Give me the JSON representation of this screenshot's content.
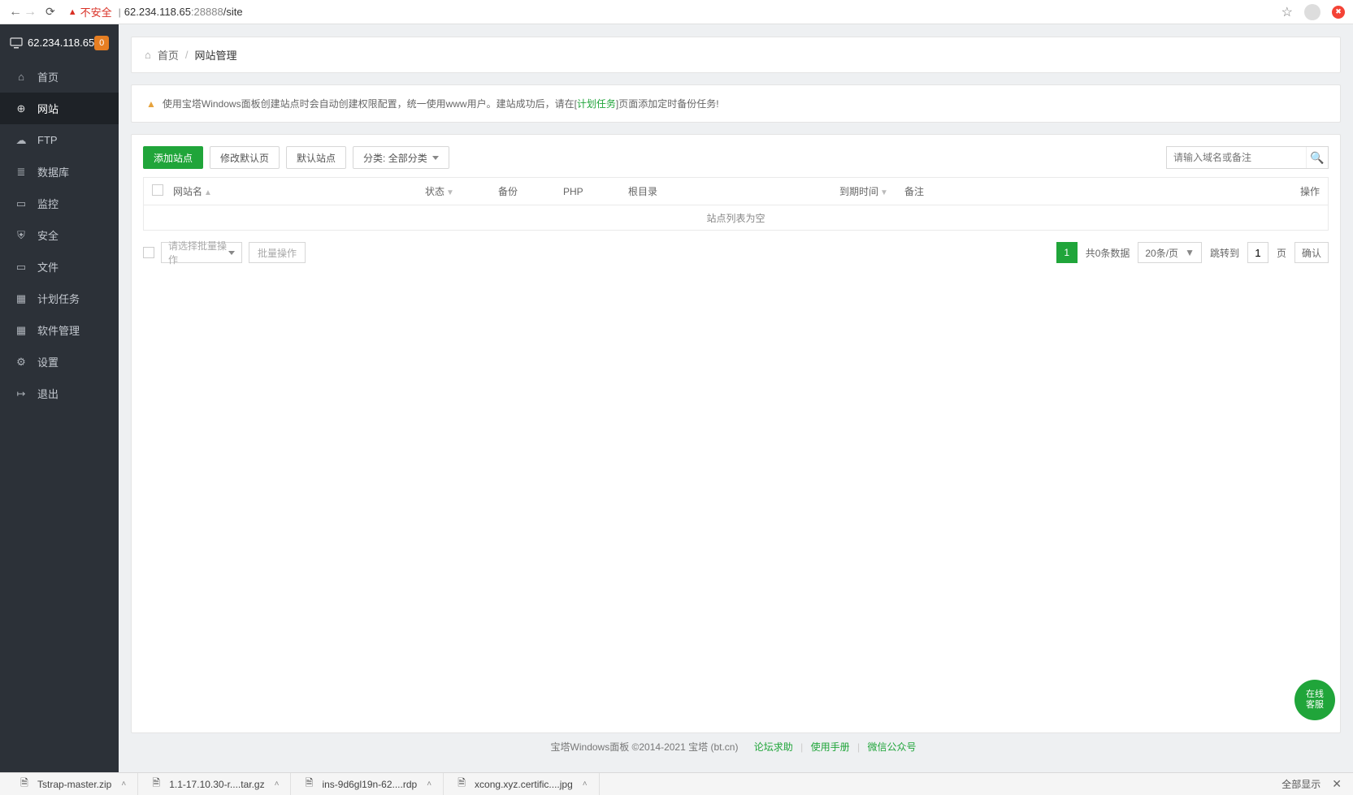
{
  "browser": {
    "insecure_label": "不安全",
    "url_host": "62.234.118.65",
    "url_port": ":28888",
    "url_path": "/site"
  },
  "sidebar": {
    "ip": "62.234.118.65",
    "badge": "0",
    "items": [
      {
        "label": "首页",
        "icon": "home"
      },
      {
        "label": "网站",
        "icon": "globe",
        "active": true
      },
      {
        "label": "FTP",
        "icon": "ftp"
      },
      {
        "label": "数据库",
        "icon": "db"
      },
      {
        "label": "监控",
        "icon": "monitor"
      },
      {
        "label": "安全",
        "icon": "shield"
      },
      {
        "label": "文件",
        "icon": "folder"
      },
      {
        "label": "计划任务",
        "icon": "calendar"
      },
      {
        "label": "软件管理",
        "icon": "apps"
      },
      {
        "label": "设置",
        "icon": "gear"
      },
      {
        "label": "退出",
        "icon": "logout"
      }
    ]
  },
  "breadcrumb": {
    "home": "首页",
    "current": "网站管理"
  },
  "tip": {
    "before": "使用宝塔Windows面板创建站点时会自动创建权限配置，统一使用www用户。建站成功后，请在[",
    "link": "计划任务",
    "after": "]页面添加定时备份任务!"
  },
  "toolbar": {
    "add": "添加站点",
    "modify_default": "修改默认页",
    "default_site": "默认站点",
    "category": "分类: 全部分类",
    "search_placeholder": "请输入域名或备注"
  },
  "table": {
    "cols": {
      "name": "网站名",
      "status": "状态",
      "backup": "备份",
      "php": "PHP",
      "root": "根目录",
      "expire": "到期时间",
      "note": "备注",
      "op": "操作"
    },
    "empty": "站点列表为空"
  },
  "bulk": {
    "select_placeholder": "请选择批量操作",
    "button": "批量操作"
  },
  "pager": {
    "current": "1",
    "total_text": "共0条数据",
    "page_size": "20条/页",
    "jump_label": "跳转到",
    "jump_value": "1",
    "page_unit": "页",
    "confirm": "确认"
  },
  "footer": {
    "text": "宝塔Windows面板 ©2014-2021 宝塔 (bt.cn)",
    "links": [
      "论坛求助",
      "使用手册",
      "微信公众号"
    ]
  },
  "float": "在线\n客服",
  "downloads": {
    "items": [
      "Tstrap-master.zip",
      "1.1-17.10.30-r....tar.gz",
      "ins-9d6gl19n-62....rdp",
      "xcong.xyz.certific....jpg"
    ],
    "show_all": "全部显示"
  }
}
